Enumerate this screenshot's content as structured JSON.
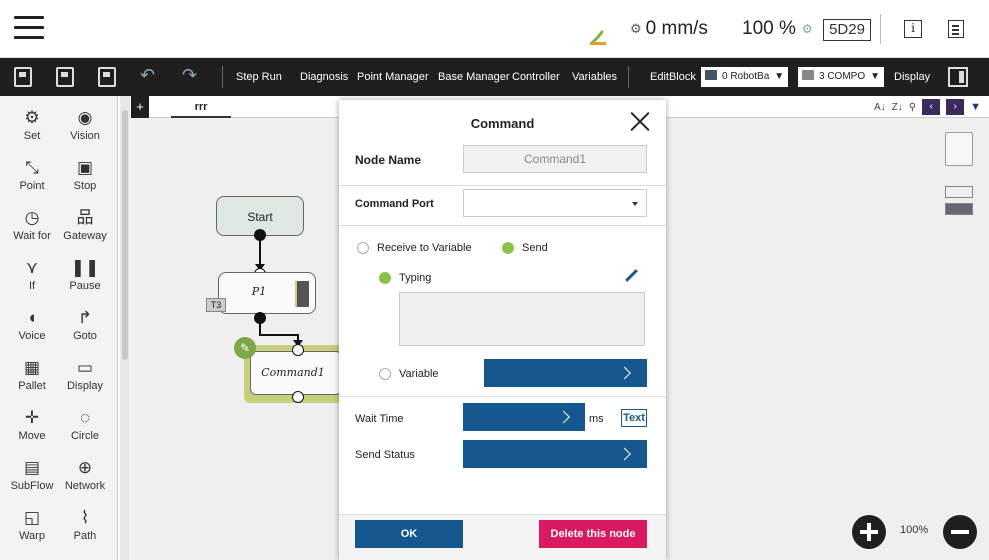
{
  "status": {
    "speed": "0 mm/s",
    "percent": "100 %",
    "badge": "5D29",
    "info_glyph": "i"
  },
  "toolbar": {
    "step_run": "Step Run",
    "diagnosis": "Diagnosis",
    "point_manager": "Point Manager",
    "base_manager": "Base Manager",
    "controller": "Controller",
    "variables": "Variables",
    "edit_block": "EditBlock",
    "robot_base": "0 RobotBa",
    "tool": "3 COMPO",
    "display": "Display"
  },
  "sidebar": {
    "items": [
      {
        "label": "Set",
        "icon": "set-icon",
        "glyph": "⚙"
      },
      {
        "label": "Vision",
        "icon": "vision-icon",
        "glyph": "◉"
      },
      {
        "label": "Point",
        "icon": "point-icon",
        "glyph": "⤡"
      },
      {
        "label": "Stop",
        "icon": "stop-icon",
        "glyph": "▣"
      },
      {
        "label": "Wait for",
        "icon": "wait-icon",
        "glyph": "◷"
      },
      {
        "label": "Gateway",
        "icon": "gateway-icon",
        "glyph": "品"
      },
      {
        "label": "If",
        "icon": "if-icon",
        "glyph": "⋎"
      },
      {
        "label": "Pause",
        "icon": "pause-icon",
        "glyph": "❚❚"
      },
      {
        "label": "Voice",
        "icon": "voice-icon",
        "glyph": "◖"
      },
      {
        "label": "Goto",
        "icon": "goto-icon",
        "glyph": "↱"
      },
      {
        "label": "Pallet",
        "icon": "pallet-icon",
        "glyph": "▦"
      },
      {
        "label": "Display",
        "icon": "display-icon",
        "glyph": "▭"
      },
      {
        "label": "Move",
        "icon": "move-icon",
        "glyph": "✛"
      },
      {
        "label": "Circle",
        "icon": "circle-icon",
        "glyph": "◌"
      },
      {
        "label": "SubFlow",
        "icon": "subflow-icon",
        "glyph": "▤"
      },
      {
        "label": "Network",
        "icon": "network-icon",
        "glyph": "⊕"
      },
      {
        "label": "Warp",
        "icon": "warp-icon",
        "glyph": "◱"
      },
      {
        "label": "Path",
        "icon": "path-icon",
        "glyph": "⌇"
      }
    ]
  },
  "canvas": {
    "tab_plus": "+",
    "tab_name": "rrr",
    "sort_az": "A↓",
    "sort_za": "Z↓",
    "nodes": {
      "start": "Start",
      "p1": "P1",
      "p1_tag": "T3",
      "command": "Command1"
    },
    "zoom": "100%"
  },
  "modal": {
    "title": "Command",
    "node_name_label": "Node Name",
    "node_name_value": "Command1",
    "command_port_label": "Command Port",
    "command_port_value": "",
    "receive_to_variable": "Receive to Variable",
    "send": "Send",
    "typing": "Typing",
    "typing_text": "",
    "variable": "Variable",
    "wait_time_label": "Wait Time",
    "wait_time_unit": "ms",
    "text_button": "Text",
    "send_status_label": "Send Status",
    "ok": "OK",
    "delete": "Delete this node",
    "colors": {
      "primary": "#14588f",
      "danger": "#d81b60",
      "radio_on": "#8bc34a"
    }
  }
}
